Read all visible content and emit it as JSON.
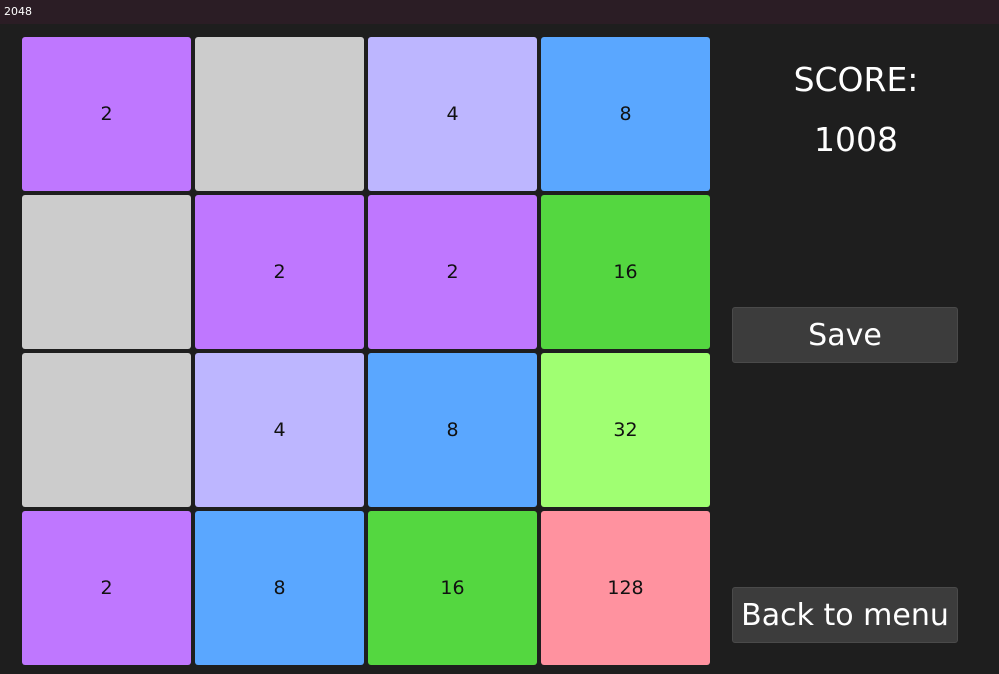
{
  "window": {
    "title": "2048"
  },
  "board": {
    "tiles": [
      {
        "value": "2",
        "color": "#bf77ff"
      },
      {
        "value": "",
        "color": "#cccccc"
      },
      {
        "value": "4",
        "color": "#bdb6ff"
      },
      {
        "value": "8",
        "color": "#5aa7ff"
      },
      {
        "value": "",
        "color": "#cccccc"
      },
      {
        "value": "2",
        "color": "#bf77ff"
      },
      {
        "value": "2",
        "color": "#bf77ff"
      },
      {
        "value": "16",
        "color": "#54d740"
      },
      {
        "value": "",
        "color": "#cccccc"
      },
      {
        "value": "4",
        "color": "#bdb6ff"
      },
      {
        "value": "8",
        "color": "#5aa7ff"
      },
      {
        "value": "32",
        "color": "#a0ff72"
      },
      {
        "value": "2",
        "color": "#bf77ff"
      },
      {
        "value": "8",
        "color": "#5aa7ff"
      },
      {
        "value": "16",
        "color": "#54d740"
      },
      {
        "value": "128",
        "color": "#ff929f"
      }
    ]
  },
  "score": {
    "label": "SCORE:",
    "value": "1008"
  },
  "buttons": {
    "save": "Save",
    "back": "Back to menu"
  }
}
